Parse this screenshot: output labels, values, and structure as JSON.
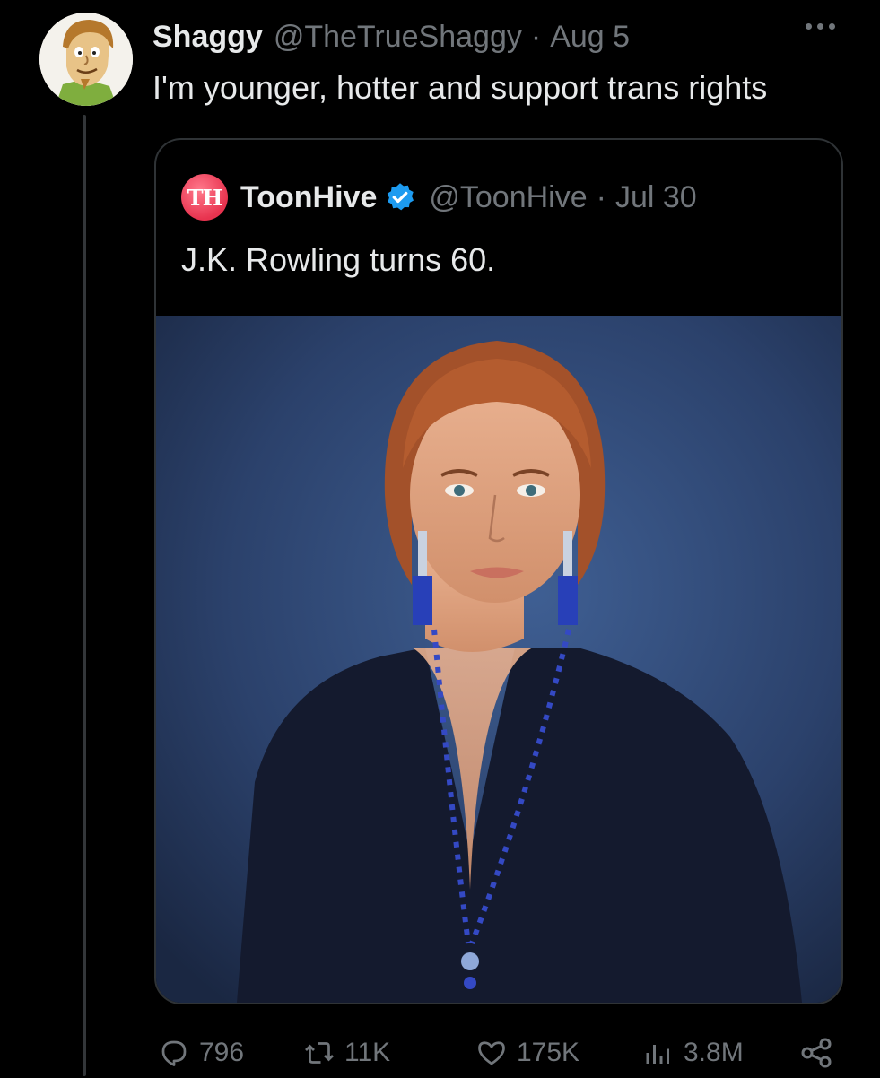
{
  "tweet": {
    "display_name": "Shaggy",
    "handle": "@TheTrueShaggy",
    "separator": "·",
    "date": "Aug 5",
    "text": "I'm younger, hotter and support trans rights",
    "avatar_icon": "shaggy-cartoon-avatar",
    "more_icon": "more-dots-icon"
  },
  "quote": {
    "avatar_text": "TH",
    "display_name": "ToonHive",
    "verified": true,
    "handle": "@ToonHive",
    "separator": "·",
    "date": "Jul 30",
    "text": "J.K. Rowling turns 60.",
    "media_icon": "portrait-photo"
  },
  "actions": {
    "reply_count": "796",
    "retweet_count": "11K",
    "like_count": "175K",
    "views_count": "3.8M"
  },
  "colors": {
    "background": "#000000",
    "text_primary": "#e7e9ea",
    "text_secondary": "#71767b",
    "border": "#2f3336",
    "verified_blue": "#1d9bf0",
    "toonhive_pink": "#e8334f"
  }
}
